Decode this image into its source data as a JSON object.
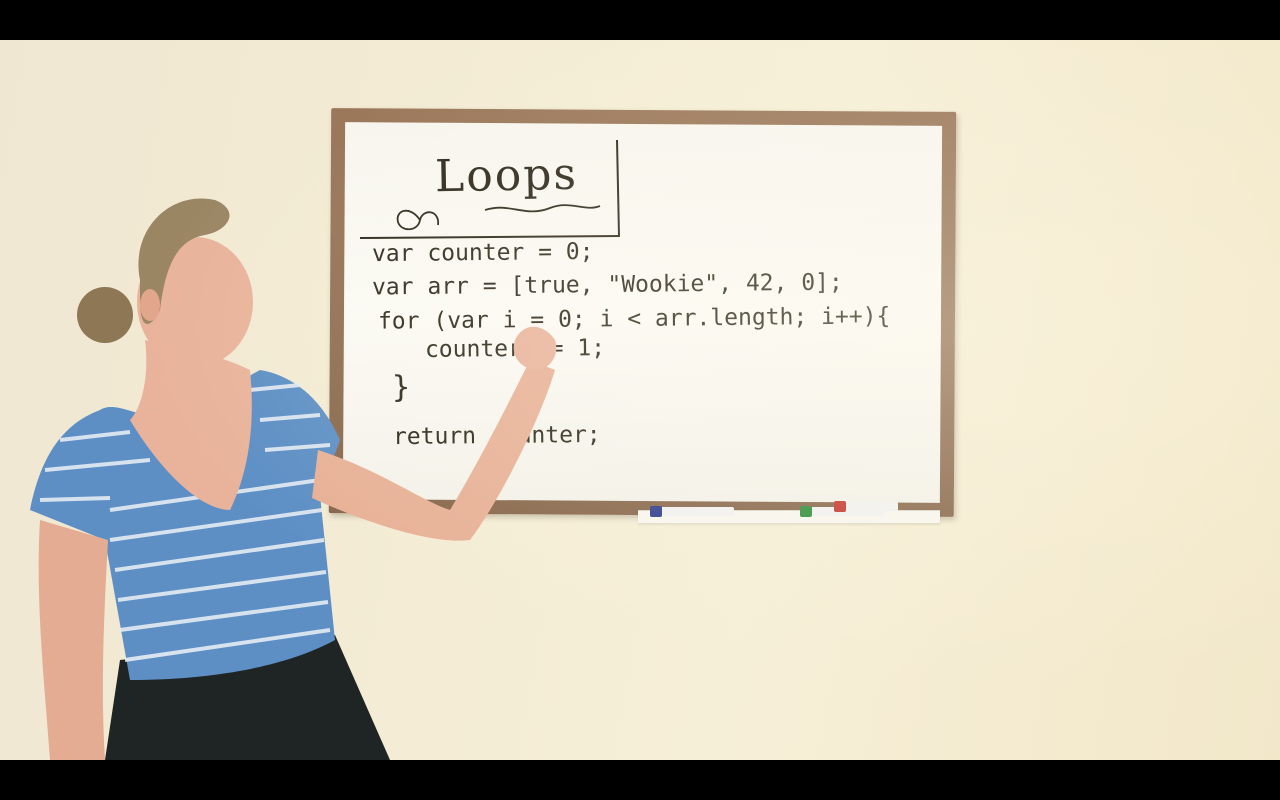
{
  "whiteboard": {
    "title": "Loops",
    "code_lines": [
      "var counter = 0;",
      "var arr = [true, \"Wookie\", 42, 0];",
      "for (var i = 0; i < arr.length; i++){",
      "counter += 1;",
      "}",
      "return counter;"
    ]
  },
  "markers": [
    {
      "color": "#2c3a8c",
      "icon": "marker-blue"
    },
    {
      "color": "#2e8b3a",
      "icon": "marker-green"
    },
    {
      "color": "#c4332a",
      "icon": "marker-red"
    }
  ]
}
